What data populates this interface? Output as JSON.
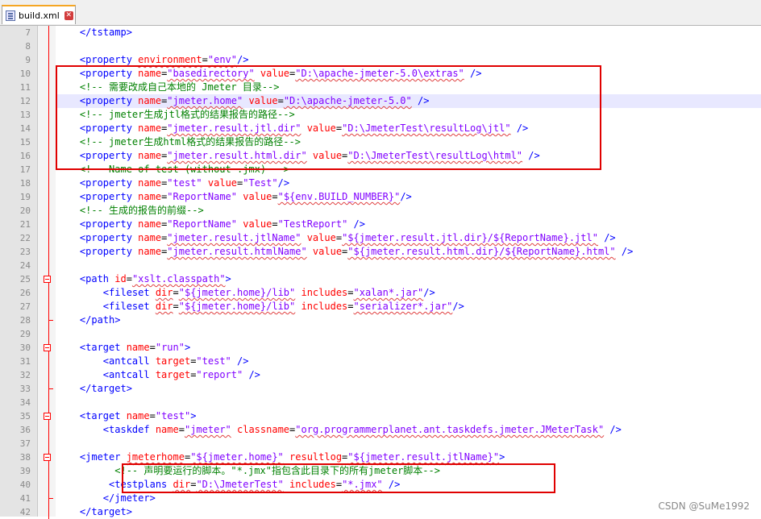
{
  "tab": {
    "title": "build.xml"
  },
  "watermark": "CSDN @SuMe1992",
  "lines": [
    {
      "n": "7",
      "fold": "",
      "hl": false,
      "tokens": [
        [
          "p",
          "    "
        ],
        [
          "tag",
          "</tstamp>"
        ]
      ]
    },
    {
      "n": "8",
      "fold": "",
      "hl": false,
      "tokens": []
    },
    {
      "n": "9",
      "fold": "",
      "hl": false,
      "tokens": [
        [
          "p",
          "    "
        ],
        [
          "tag",
          "<property "
        ],
        [
          "attr",
          "environment"
        ],
        [
          "p",
          "="
        ],
        [
          "val",
          "\"env\""
        ],
        [
          "tag",
          "/>"
        ]
      ]
    },
    {
      "n": "10",
      "fold": "",
      "hl": false,
      "tokens": [
        [
          "p",
          "    "
        ],
        [
          "tag",
          "<property "
        ],
        [
          "attr",
          "name"
        ],
        [
          "p",
          "="
        ],
        [
          "val",
          "\"basedirectory\""
        ],
        [
          "p",
          " "
        ],
        [
          "attr",
          "value"
        ],
        [
          "p",
          "="
        ],
        [
          "val",
          "\"D:\\apache-jmeter-5.0\\extras\""
        ],
        [
          "p",
          " "
        ],
        [
          "tag",
          "/>"
        ]
      ]
    },
    {
      "n": "11",
      "fold": "",
      "hl": false,
      "tokens": [
        [
          "p",
          "    "
        ],
        [
          "com",
          "<!-- 需要改成自己本地的 Jmeter 目录-->"
        ]
      ]
    },
    {
      "n": "12",
      "fold": "",
      "hl": true,
      "tokens": [
        [
          "p",
          "    "
        ],
        [
          "tag",
          "<property "
        ],
        [
          "attr",
          "name"
        ],
        [
          "p",
          "="
        ],
        [
          "val",
          "\"jmeter.home\""
        ],
        [
          "p",
          " "
        ],
        [
          "attr",
          "value"
        ],
        [
          "p",
          "="
        ],
        [
          "val",
          "\"D:\\apache-jmeter-5.0\""
        ],
        [
          "p",
          " "
        ],
        [
          "tag",
          "/>"
        ]
      ]
    },
    {
      "n": "13",
      "fold": "",
      "hl": false,
      "tokens": [
        [
          "p",
          "    "
        ],
        [
          "com",
          "<!-- jmeter生成jtl格式的结果报告的路径-->"
        ]
      ]
    },
    {
      "n": "14",
      "fold": "",
      "hl": false,
      "tokens": [
        [
          "p",
          "    "
        ],
        [
          "tag",
          "<property "
        ],
        [
          "attr",
          "name"
        ],
        [
          "p",
          "="
        ],
        [
          "val",
          "\"jmeter.result.jtl.dir\""
        ],
        [
          "p",
          " "
        ],
        [
          "attr",
          "value"
        ],
        [
          "p",
          "="
        ],
        [
          "val",
          "\"D:\\JmeterTest\\resultLog\\jtl\""
        ],
        [
          "p",
          " "
        ],
        [
          "tag",
          "/>"
        ]
      ]
    },
    {
      "n": "15",
      "fold": "",
      "hl": false,
      "tokens": [
        [
          "p",
          "    "
        ],
        [
          "com",
          "<!-- jmeter生成html格式的结果报告的路径-->"
        ]
      ]
    },
    {
      "n": "16",
      "fold": "",
      "hl": false,
      "tokens": [
        [
          "p",
          "    "
        ],
        [
          "tag",
          "<property "
        ],
        [
          "attr",
          "name"
        ],
        [
          "p",
          "="
        ],
        [
          "val",
          "\"jmeter.result.html.dir\""
        ],
        [
          "p",
          " "
        ],
        [
          "attr",
          "value"
        ],
        [
          "p",
          "="
        ],
        [
          "val",
          "\"D:\\JmeterTest\\resultLog\\html\""
        ],
        [
          "p",
          " "
        ],
        [
          "tag",
          "/>"
        ]
      ]
    },
    {
      "n": "17",
      "fold": "",
      "hl": false,
      "tokens": [
        [
          "p",
          "    "
        ],
        [
          "com",
          "<!-- Name of test (without .jmx) -->"
        ]
      ]
    },
    {
      "n": "18",
      "fold": "",
      "hl": false,
      "tokens": [
        [
          "p",
          "    "
        ],
        [
          "tag",
          "<property "
        ],
        [
          "attr",
          "name"
        ],
        [
          "p",
          "="
        ],
        [
          "val",
          "\"test\""
        ],
        [
          "p",
          " "
        ],
        [
          "attr",
          "value"
        ],
        [
          "p",
          "="
        ],
        [
          "val",
          "\"Test\""
        ],
        [
          "tag",
          "/>"
        ]
      ]
    },
    {
      "n": "19",
      "fold": "",
      "hl": false,
      "tokens": [
        [
          "p",
          "    "
        ],
        [
          "tag",
          "<property "
        ],
        [
          "attr",
          "name"
        ],
        [
          "p",
          "="
        ],
        [
          "val",
          "\"ReportName\""
        ],
        [
          "p",
          " "
        ],
        [
          "attr",
          "value"
        ],
        [
          "p",
          "="
        ],
        [
          "val",
          "\"${env.BUILD_NUMBER}\""
        ],
        [
          "tag",
          "/>"
        ]
      ]
    },
    {
      "n": "20",
      "fold": "",
      "hl": false,
      "tokens": [
        [
          "p",
          "    "
        ],
        [
          "com",
          "<!-- 生成的报告的前缀-->"
        ]
      ]
    },
    {
      "n": "21",
      "fold": "",
      "hl": false,
      "tokens": [
        [
          "p",
          "    "
        ],
        [
          "tag",
          "<property "
        ],
        [
          "attr",
          "name"
        ],
        [
          "p",
          "="
        ],
        [
          "val",
          "\"ReportName\""
        ],
        [
          "p",
          " "
        ],
        [
          "attr",
          "value"
        ],
        [
          "p",
          "="
        ],
        [
          "val",
          "\"TestReport\""
        ],
        [
          "p",
          " "
        ],
        [
          "tag",
          "/>"
        ]
      ]
    },
    {
      "n": "22",
      "fold": "",
      "hl": false,
      "tokens": [
        [
          "p",
          "    "
        ],
        [
          "tag",
          "<property "
        ],
        [
          "attr",
          "name"
        ],
        [
          "p",
          "="
        ],
        [
          "val",
          "\"jmeter.result.jtlName\""
        ],
        [
          "p",
          " "
        ],
        [
          "attr",
          "value"
        ],
        [
          "p",
          "="
        ],
        [
          "val",
          "\"${jmeter.result.jtl.dir}/${ReportName}.jtl\""
        ],
        [
          "p",
          " "
        ],
        [
          "tag",
          "/>"
        ]
      ]
    },
    {
      "n": "23",
      "fold": "",
      "hl": false,
      "tokens": [
        [
          "p",
          "    "
        ],
        [
          "tag",
          "<property "
        ],
        [
          "attr",
          "name"
        ],
        [
          "p",
          "="
        ],
        [
          "val",
          "\"jmeter.result.htmlName\""
        ],
        [
          "p",
          " "
        ],
        [
          "attr",
          "value"
        ],
        [
          "p",
          "="
        ],
        [
          "val",
          "\"${jmeter.result.html.dir}/${ReportName}.html\""
        ],
        [
          "p",
          " "
        ],
        [
          "tag",
          "/>"
        ]
      ]
    },
    {
      "n": "24",
      "fold": "",
      "hl": false,
      "tokens": []
    },
    {
      "n": "25",
      "fold": "open",
      "hl": false,
      "tokens": [
        [
          "p",
          "    "
        ],
        [
          "tag",
          "<path "
        ],
        [
          "attr",
          "id"
        ],
        [
          "p",
          "="
        ],
        [
          "val",
          "\"xslt.classpath\""
        ],
        [
          "tag",
          ">"
        ]
      ]
    },
    {
      "n": "26",
      "fold": "",
      "hl": false,
      "tokens": [
        [
          "p",
          "        "
        ],
        [
          "tag",
          "<fileset "
        ],
        [
          "attr",
          "dir"
        ],
        [
          "p",
          "="
        ],
        [
          "val",
          "\"${jmeter.home}/lib\""
        ],
        [
          "p",
          " "
        ],
        [
          "attr",
          "includes"
        ],
        [
          "p",
          "="
        ],
        [
          "val",
          "\"xalan*.jar\""
        ],
        [
          "tag",
          "/>"
        ]
      ]
    },
    {
      "n": "27",
      "fold": "",
      "hl": false,
      "tokens": [
        [
          "p",
          "        "
        ],
        [
          "tag",
          "<fileset "
        ],
        [
          "attr",
          "dir"
        ],
        [
          "p",
          "="
        ],
        [
          "val",
          "\"${jmeter.home}/lib\""
        ],
        [
          "p",
          " "
        ],
        [
          "attr",
          "includes"
        ],
        [
          "p",
          "="
        ],
        [
          "val",
          "\"serializer*.jar\""
        ],
        [
          "tag",
          "/>"
        ]
      ]
    },
    {
      "n": "28",
      "fold": "end",
      "hl": false,
      "tokens": [
        [
          "p",
          "    "
        ],
        [
          "tag",
          "</path>"
        ]
      ]
    },
    {
      "n": "29",
      "fold": "",
      "hl": false,
      "tokens": []
    },
    {
      "n": "30",
      "fold": "open",
      "hl": false,
      "tokens": [
        [
          "p",
          "    "
        ],
        [
          "tag",
          "<target "
        ],
        [
          "attr",
          "name"
        ],
        [
          "p",
          "="
        ],
        [
          "val",
          "\"run\""
        ],
        [
          "tag",
          ">"
        ]
      ]
    },
    {
      "n": "31",
      "fold": "",
      "hl": false,
      "tokens": [
        [
          "p",
          "        "
        ],
        [
          "tag",
          "<antcall "
        ],
        [
          "attr",
          "target"
        ],
        [
          "p",
          "="
        ],
        [
          "val",
          "\"test\""
        ],
        [
          "p",
          " "
        ],
        [
          "tag",
          "/>"
        ]
      ]
    },
    {
      "n": "32",
      "fold": "",
      "hl": false,
      "tokens": [
        [
          "p",
          "        "
        ],
        [
          "tag",
          "<antcall "
        ],
        [
          "attr",
          "target"
        ],
        [
          "p",
          "="
        ],
        [
          "val",
          "\"report\""
        ],
        [
          "p",
          " "
        ],
        [
          "tag",
          "/>"
        ]
      ]
    },
    {
      "n": "33",
      "fold": "end",
      "hl": false,
      "tokens": [
        [
          "p",
          "    "
        ],
        [
          "tag",
          "</target>"
        ]
      ]
    },
    {
      "n": "34",
      "fold": "",
      "hl": false,
      "tokens": []
    },
    {
      "n": "35",
      "fold": "open",
      "hl": false,
      "tokens": [
        [
          "p",
          "    "
        ],
        [
          "tag",
          "<target "
        ],
        [
          "attr",
          "name"
        ],
        [
          "p",
          "="
        ],
        [
          "val",
          "\"test\""
        ],
        [
          "tag",
          ">"
        ]
      ]
    },
    {
      "n": "36",
      "fold": "",
      "hl": false,
      "tokens": [
        [
          "p",
          "        "
        ],
        [
          "tag",
          "<taskdef "
        ],
        [
          "attr",
          "name"
        ],
        [
          "p",
          "="
        ],
        [
          "val",
          "\"jmeter\""
        ],
        [
          "p",
          " "
        ],
        [
          "attr",
          "classname"
        ],
        [
          "p",
          "="
        ],
        [
          "val",
          "\"org.programmerplanet.ant.taskdefs.jmeter.JMeterTask\""
        ],
        [
          "p",
          " "
        ],
        [
          "tag",
          "/>"
        ]
      ]
    },
    {
      "n": "37",
      "fold": "",
      "hl": false,
      "tokens": []
    },
    {
      "n": "38",
      "fold": "open",
      "hl": false,
      "tokens": [
        [
          "p",
          "    "
        ],
        [
          "tag",
          "<jmeter "
        ],
        [
          "attr",
          "jmeterhome"
        ],
        [
          "p",
          "="
        ],
        [
          "val",
          "\"${jmeter.home}\""
        ],
        [
          "p",
          " "
        ],
        [
          "attr",
          "resultlog"
        ],
        [
          "p",
          "="
        ],
        [
          "val",
          "\"${jmeter.result.jtlName}\""
        ],
        [
          "tag",
          ">"
        ]
      ]
    },
    {
      "n": "39",
      "fold": "",
      "hl": false,
      "tokens": [
        [
          "p",
          "          "
        ],
        [
          "com",
          "<!-- 声明要运行的脚本。\"*.jmx\"指包含此目录下的所有jmeter脚本-->"
        ]
      ]
    },
    {
      "n": "40",
      "fold": "",
      "hl": false,
      "tokens": [
        [
          "p",
          "         "
        ],
        [
          "tag",
          "<testplans "
        ],
        [
          "attr",
          "dir"
        ],
        [
          "p",
          "="
        ],
        [
          "val",
          "\"D:\\JmeterTest\""
        ],
        [
          "p",
          " "
        ],
        [
          "attr",
          "includes"
        ],
        [
          "p",
          "="
        ],
        [
          "val",
          "\"*.jmx\""
        ],
        [
          "p",
          " "
        ],
        [
          "tag",
          "/>"
        ]
      ]
    },
    {
      "n": "41",
      "fold": "end",
      "hl": false,
      "tokens": [
        [
          "p",
          "        "
        ],
        [
          "tag",
          "</jmeter>"
        ]
      ]
    },
    {
      "n": "42",
      "fold": "",
      "hl": false,
      "tokens": [
        [
          "p",
          "    "
        ],
        [
          "tag",
          "</target>"
        ]
      ]
    }
  ]
}
